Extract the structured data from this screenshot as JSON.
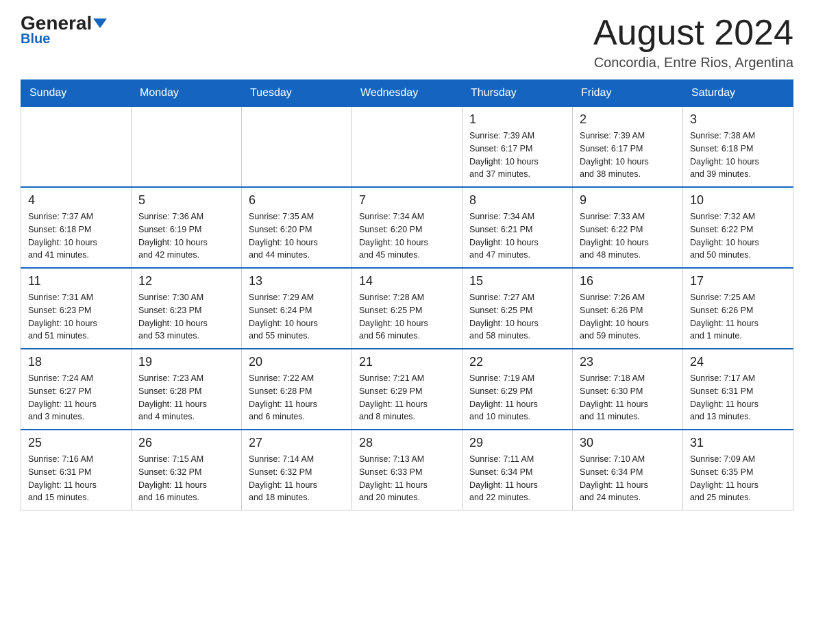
{
  "header": {
    "logo_text_black": "General",
    "logo_text_blue": "Blue",
    "month_title": "August 2024",
    "location": "Concordia, Entre Rios, Argentina"
  },
  "days_of_week": [
    "Sunday",
    "Monday",
    "Tuesday",
    "Wednesday",
    "Thursday",
    "Friday",
    "Saturday"
  ],
  "weeks": [
    {
      "days": [
        {
          "number": "",
          "info": ""
        },
        {
          "number": "",
          "info": ""
        },
        {
          "number": "",
          "info": ""
        },
        {
          "number": "",
          "info": ""
        },
        {
          "number": "1",
          "info": "Sunrise: 7:39 AM\nSunset: 6:17 PM\nDaylight: 10 hours\nand 37 minutes."
        },
        {
          "number": "2",
          "info": "Sunrise: 7:39 AM\nSunset: 6:17 PM\nDaylight: 10 hours\nand 38 minutes."
        },
        {
          "number": "3",
          "info": "Sunrise: 7:38 AM\nSunset: 6:18 PM\nDaylight: 10 hours\nand 39 minutes."
        }
      ]
    },
    {
      "days": [
        {
          "number": "4",
          "info": "Sunrise: 7:37 AM\nSunset: 6:18 PM\nDaylight: 10 hours\nand 41 minutes."
        },
        {
          "number": "5",
          "info": "Sunrise: 7:36 AM\nSunset: 6:19 PM\nDaylight: 10 hours\nand 42 minutes."
        },
        {
          "number": "6",
          "info": "Sunrise: 7:35 AM\nSunset: 6:20 PM\nDaylight: 10 hours\nand 44 minutes."
        },
        {
          "number": "7",
          "info": "Sunrise: 7:34 AM\nSunset: 6:20 PM\nDaylight: 10 hours\nand 45 minutes."
        },
        {
          "number": "8",
          "info": "Sunrise: 7:34 AM\nSunset: 6:21 PM\nDaylight: 10 hours\nand 47 minutes."
        },
        {
          "number": "9",
          "info": "Sunrise: 7:33 AM\nSunset: 6:22 PM\nDaylight: 10 hours\nand 48 minutes."
        },
        {
          "number": "10",
          "info": "Sunrise: 7:32 AM\nSunset: 6:22 PM\nDaylight: 10 hours\nand 50 minutes."
        }
      ]
    },
    {
      "days": [
        {
          "number": "11",
          "info": "Sunrise: 7:31 AM\nSunset: 6:23 PM\nDaylight: 10 hours\nand 51 minutes."
        },
        {
          "number": "12",
          "info": "Sunrise: 7:30 AM\nSunset: 6:23 PM\nDaylight: 10 hours\nand 53 minutes."
        },
        {
          "number": "13",
          "info": "Sunrise: 7:29 AM\nSunset: 6:24 PM\nDaylight: 10 hours\nand 55 minutes."
        },
        {
          "number": "14",
          "info": "Sunrise: 7:28 AM\nSunset: 6:25 PM\nDaylight: 10 hours\nand 56 minutes."
        },
        {
          "number": "15",
          "info": "Sunrise: 7:27 AM\nSunset: 6:25 PM\nDaylight: 10 hours\nand 58 minutes."
        },
        {
          "number": "16",
          "info": "Sunrise: 7:26 AM\nSunset: 6:26 PM\nDaylight: 10 hours\nand 59 minutes."
        },
        {
          "number": "17",
          "info": "Sunrise: 7:25 AM\nSunset: 6:26 PM\nDaylight: 11 hours\nand 1 minute."
        }
      ]
    },
    {
      "days": [
        {
          "number": "18",
          "info": "Sunrise: 7:24 AM\nSunset: 6:27 PM\nDaylight: 11 hours\nand 3 minutes."
        },
        {
          "number": "19",
          "info": "Sunrise: 7:23 AM\nSunset: 6:28 PM\nDaylight: 11 hours\nand 4 minutes."
        },
        {
          "number": "20",
          "info": "Sunrise: 7:22 AM\nSunset: 6:28 PM\nDaylight: 11 hours\nand 6 minutes."
        },
        {
          "number": "21",
          "info": "Sunrise: 7:21 AM\nSunset: 6:29 PM\nDaylight: 11 hours\nand 8 minutes."
        },
        {
          "number": "22",
          "info": "Sunrise: 7:19 AM\nSunset: 6:29 PM\nDaylight: 11 hours\nand 10 minutes."
        },
        {
          "number": "23",
          "info": "Sunrise: 7:18 AM\nSunset: 6:30 PM\nDaylight: 11 hours\nand 11 minutes."
        },
        {
          "number": "24",
          "info": "Sunrise: 7:17 AM\nSunset: 6:31 PM\nDaylight: 11 hours\nand 13 minutes."
        }
      ]
    },
    {
      "days": [
        {
          "number": "25",
          "info": "Sunrise: 7:16 AM\nSunset: 6:31 PM\nDaylight: 11 hours\nand 15 minutes."
        },
        {
          "number": "26",
          "info": "Sunrise: 7:15 AM\nSunset: 6:32 PM\nDaylight: 11 hours\nand 16 minutes."
        },
        {
          "number": "27",
          "info": "Sunrise: 7:14 AM\nSunset: 6:32 PM\nDaylight: 11 hours\nand 18 minutes."
        },
        {
          "number": "28",
          "info": "Sunrise: 7:13 AM\nSunset: 6:33 PM\nDaylight: 11 hours\nand 20 minutes."
        },
        {
          "number": "29",
          "info": "Sunrise: 7:11 AM\nSunset: 6:34 PM\nDaylight: 11 hours\nand 22 minutes."
        },
        {
          "number": "30",
          "info": "Sunrise: 7:10 AM\nSunset: 6:34 PM\nDaylight: 11 hours\nand 24 minutes."
        },
        {
          "number": "31",
          "info": "Sunrise: 7:09 AM\nSunset: 6:35 PM\nDaylight: 11 hours\nand 25 minutes."
        }
      ]
    }
  ]
}
